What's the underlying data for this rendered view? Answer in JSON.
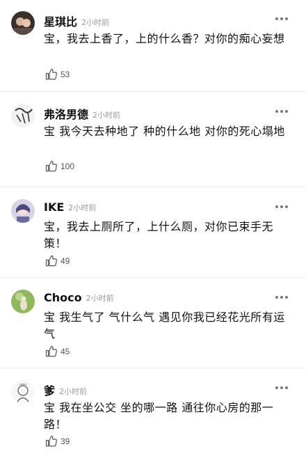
{
  "comments": [
    {
      "user": "星琪比",
      "time": "2小时前",
      "text": "宝，我去上香了，上的什么香？对你的痴心妄想",
      "likes": "53",
      "avatar": "photo-avatar"
    },
    {
      "user": "弗洛男德",
      "time": "2小时前",
      "text": "宝 我今天去种地了 种的什么地 对你的死心塌地",
      "likes": "100",
      "avatar": "sketch-avatar"
    },
    {
      "user": "IKE",
      "time": "2小时前",
      "text": "宝，我去上厕所了，上什么厕，对你已束手无策！",
      "likes": "49",
      "avatar": "anime-avatar"
    },
    {
      "user": "Choco",
      "time": "2小时前",
      "text": "宝 我生气了 气什么气 遇见你我已经花光所有运气",
      "likes": "45",
      "avatar": "green-avatar"
    },
    {
      "user": "爹",
      "time": "2小时前",
      "text": "宝 我在坐公交 坐的哪一路 通往你心房的那一路！",
      "likes": "39",
      "avatar": "drawing-avatar"
    }
  ],
  "icons": {
    "more": "more-dots-icon",
    "like": "thumbs-up-icon"
  }
}
